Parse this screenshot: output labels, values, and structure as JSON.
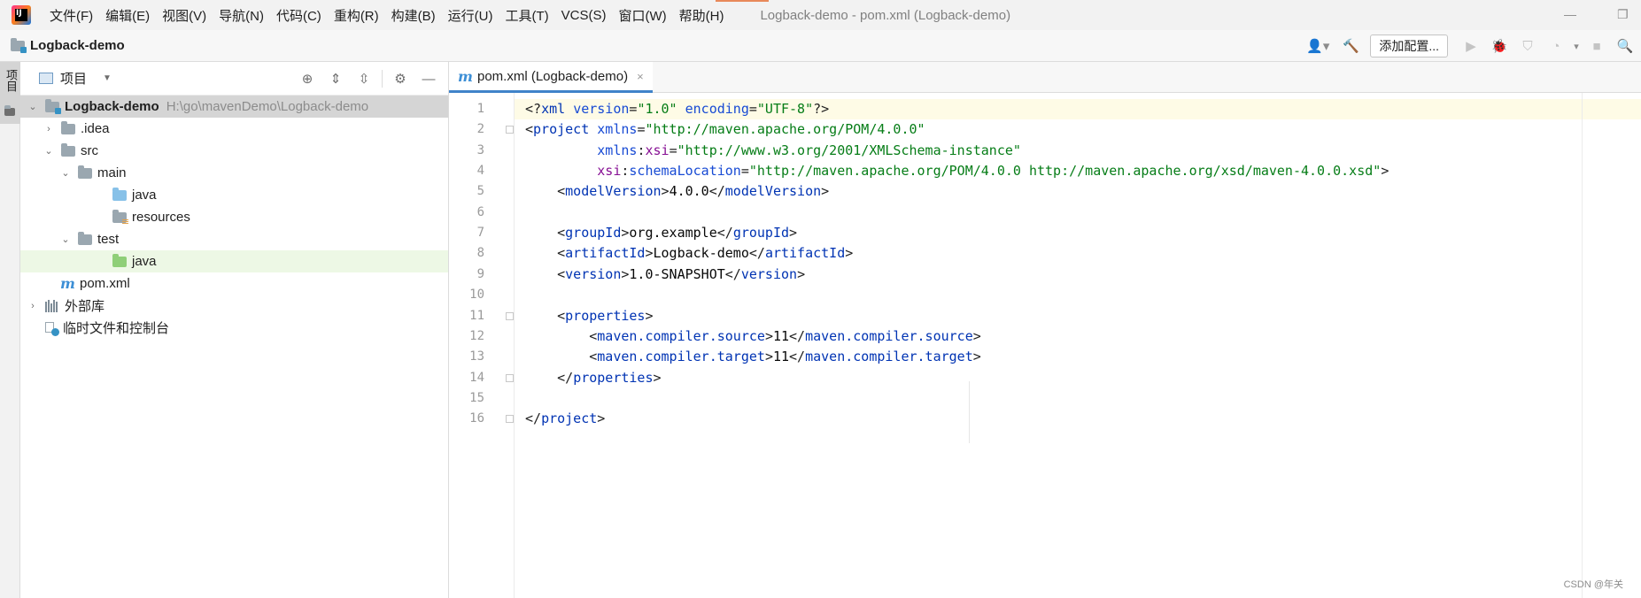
{
  "app": {
    "icon_label": "IJ",
    "window_title": "Logback-demo - pom.xml (Logback-demo)"
  },
  "menu": [
    {
      "label": "文件(F)"
    },
    {
      "label": "编辑(E)"
    },
    {
      "label": "视图(V)"
    },
    {
      "label": "导航(N)"
    },
    {
      "label": "代码(C)"
    },
    {
      "label": "重构(R)"
    },
    {
      "label": "构建(B)"
    },
    {
      "label": "运行(U)"
    },
    {
      "label": "工具(T)"
    },
    {
      "label": "VCS(S)"
    },
    {
      "label": "窗口(W)"
    },
    {
      "label": "帮助(H)"
    }
  ],
  "window_controls": {
    "minimize": "—",
    "restore": "❐"
  },
  "navbar": {
    "project_name": "Logback-demo",
    "add_config_label": "添加配置...",
    "icons": {
      "user": "👤▾",
      "build": "🔨",
      "run": "▶",
      "debug": "🐞",
      "coverage": "⛉",
      "profile": "◔",
      "more": "▾",
      "stop": "■",
      "search": "🔍"
    }
  },
  "left_stripe": {
    "label": "项目"
  },
  "project_panel": {
    "title": "项目",
    "dropdown": "▼",
    "tools": {
      "locate": "⊕",
      "expand": "⇕",
      "collapse": "⇳",
      "settings": "⚙",
      "hide": "—"
    },
    "tree": [
      {
        "label": "Logback-demo",
        "path": "H:\\go\\mavenDemo\\Logback-demo",
        "arrow": "⌄",
        "icon": "module-folder"
      },
      {
        "label": ".idea",
        "arrow": "›",
        "icon": "folder"
      },
      {
        "label": "src",
        "arrow": "⌄",
        "icon": "folder"
      },
      {
        "label": "main",
        "arrow": "⌄",
        "icon": "folder"
      },
      {
        "label": "java",
        "arrow": "",
        "icon": "source-folder"
      },
      {
        "label": "resources",
        "arrow": "",
        "icon": "resources-folder"
      },
      {
        "label": "test",
        "arrow": "⌄",
        "icon": "folder"
      },
      {
        "label": "java",
        "arrow": "",
        "icon": "test-folder"
      },
      {
        "label": "pom.xml",
        "arrow": "",
        "icon": "maven-file",
        "icon_glyph": "m"
      },
      {
        "label": "外部库",
        "arrow": "›",
        "icon": "library"
      },
      {
        "label": "临时文件和控制台",
        "arrow": "",
        "icon": "scratch"
      }
    ]
  },
  "editor": {
    "tab_label": "pom.xml (Logback-demo)",
    "tab_icon_glyph": "m",
    "tab_close": "×",
    "lines": [
      {
        "n": "1",
        "tokens": [
          [
            "t-br",
            "<?"
          ],
          [
            "t-tag",
            "xml"
          ],
          [
            "t-br",
            " "
          ],
          [
            "t-attr",
            "version"
          ],
          [
            "t-br",
            "="
          ],
          [
            "t-val",
            "\"1.0\""
          ],
          [
            "t-br",
            " "
          ],
          [
            "t-attr",
            "encoding"
          ],
          [
            "t-br",
            "="
          ],
          [
            "t-val",
            "\"UTF-8\""
          ],
          [
            "t-br",
            "?>"
          ]
        ]
      },
      {
        "n": "2",
        "tokens": [
          [
            "t-br",
            "<"
          ],
          [
            "t-tag",
            "project"
          ],
          [
            "t-br",
            " "
          ],
          [
            "t-attr",
            "xmlns"
          ],
          [
            "t-br",
            "="
          ],
          [
            "t-val",
            "\"http://maven.apache.org/POM/4.0.0\""
          ]
        ]
      },
      {
        "n": "3",
        "tokens": [
          [
            "t-br",
            "         "
          ],
          [
            "t-attr",
            "xmlns"
          ],
          [
            "t-br",
            ":"
          ],
          [
            "t-ns",
            "xsi"
          ],
          [
            "t-br",
            "="
          ],
          [
            "t-val",
            "\"http://www.w3.org/2001/XMLSchema-instance\""
          ]
        ]
      },
      {
        "n": "4",
        "tokens": [
          [
            "t-br",
            "         "
          ],
          [
            "t-ns",
            "xsi"
          ],
          [
            "t-br",
            ":"
          ],
          [
            "t-attr",
            "schemaLocation"
          ],
          [
            "t-br",
            "="
          ],
          [
            "t-val",
            "\"http://maven.apache.org/POM/4.0.0 http://maven.apache.org/xsd/maven-4.0.0.xsd\""
          ],
          [
            "t-br",
            ">"
          ]
        ]
      },
      {
        "n": "5",
        "tokens": [
          [
            "t-br",
            "    <"
          ],
          [
            "t-tag",
            "modelVersion"
          ],
          [
            "t-br",
            ">"
          ],
          [
            "t-txt",
            "4.0.0"
          ],
          [
            "t-br",
            "</"
          ],
          [
            "t-tag",
            "modelVersion"
          ],
          [
            "t-br",
            ">"
          ]
        ]
      },
      {
        "n": "6",
        "tokens": []
      },
      {
        "n": "7",
        "tokens": [
          [
            "t-br",
            "    <"
          ],
          [
            "t-tag",
            "groupId"
          ],
          [
            "t-br",
            ">"
          ],
          [
            "t-txt",
            "org.example"
          ],
          [
            "t-br",
            "</"
          ],
          [
            "t-tag",
            "groupId"
          ],
          [
            "t-br",
            ">"
          ]
        ]
      },
      {
        "n": "8",
        "tokens": [
          [
            "t-br",
            "    <"
          ],
          [
            "t-tag",
            "artifactId"
          ],
          [
            "t-br",
            ">"
          ],
          [
            "t-txt",
            "Logback-demo"
          ],
          [
            "t-br",
            "</"
          ],
          [
            "t-tag",
            "artifactId"
          ],
          [
            "t-br",
            ">"
          ]
        ]
      },
      {
        "n": "9",
        "tokens": [
          [
            "t-br",
            "    <"
          ],
          [
            "t-tag",
            "version"
          ],
          [
            "t-br",
            ">"
          ],
          [
            "t-txt",
            "1.0-SNAPSHOT"
          ],
          [
            "t-br",
            "</"
          ],
          [
            "t-tag",
            "version"
          ],
          [
            "t-br",
            ">"
          ]
        ]
      },
      {
        "n": "10",
        "tokens": []
      },
      {
        "n": "11",
        "tokens": [
          [
            "t-br",
            "    <"
          ],
          [
            "t-tag",
            "properties"
          ],
          [
            "t-br",
            ">"
          ]
        ]
      },
      {
        "n": "12",
        "tokens": [
          [
            "t-br",
            "        <"
          ],
          [
            "t-tag",
            "maven.compiler.source"
          ],
          [
            "t-br",
            ">"
          ],
          [
            "t-txt",
            "11"
          ],
          [
            "t-br",
            "</"
          ],
          [
            "t-tag",
            "maven.compiler.source"
          ],
          [
            "t-br",
            ">"
          ]
        ]
      },
      {
        "n": "13",
        "tokens": [
          [
            "t-br",
            "        <"
          ],
          [
            "t-tag",
            "maven.compiler.target"
          ],
          [
            "t-br",
            ">"
          ],
          [
            "t-txt",
            "11"
          ],
          [
            "t-br",
            "</"
          ],
          [
            "t-tag",
            "maven.compiler.target"
          ],
          [
            "t-br",
            ">"
          ]
        ]
      },
      {
        "n": "14",
        "tokens": [
          [
            "t-br",
            "    </"
          ],
          [
            "t-tag",
            "properties"
          ],
          [
            "t-br",
            ">"
          ]
        ]
      },
      {
        "n": "15",
        "tokens": []
      },
      {
        "n": "16",
        "tokens": [
          [
            "t-br",
            "</"
          ],
          [
            "t-tag",
            "project"
          ],
          [
            "t-br",
            ">"
          ]
        ]
      }
    ]
  },
  "watermark": "CSDN @年关"
}
